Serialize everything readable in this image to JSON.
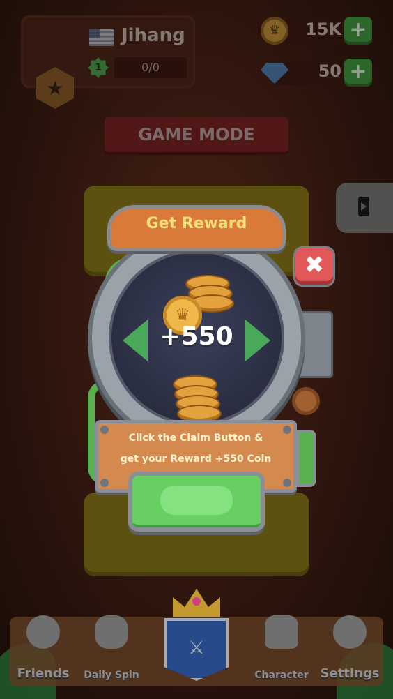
{
  "profile": {
    "player_name": "Jihang",
    "level": "1",
    "xp_text": "0/0"
  },
  "currency": {
    "coins": "15K",
    "gems": "50",
    "plus_label": "+"
  },
  "game_mode_title": "GAME MODE",
  "modal": {
    "title": "Get Reward",
    "reward_amount": "+550",
    "close_label": "✖",
    "instruction_line1": "Cilck the Claim Button &",
    "instruction_line2": "get your Reward +550 Coin",
    "claim_button_label": ""
  },
  "nav": {
    "friends": "Friends",
    "daily_spin": "Daily Spin",
    "character": "Character",
    "settings": "Settings"
  },
  "icons": {
    "coin": "crown-coin-icon",
    "gem": "diamond-icon",
    "rank": "star-hexagon-icon"
  },
  "colors": {
    "reward_title_bg": "#d97a3a",
    "reward_title_text": "#f4e07a",
    "claim_button": "#68d062",
    "close_button": "#e25858",
    "plus_button": "#3f9a3f"
  }
}
